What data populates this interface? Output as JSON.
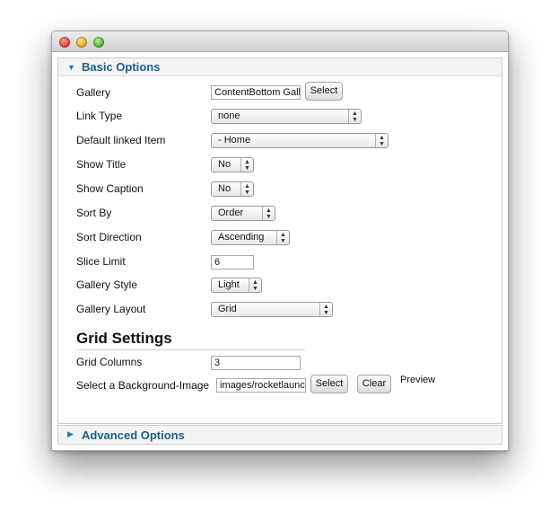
{
  "window": {
    "controls": [
      "close-button",
      "minimize-button",
      "zoom-button"
    ]
  },
  "basic": {
    "title": "Basic Options",
    "arrow": "▼"
  },
  "advanced": {
    "title": "Advanced Options",
    "arrow": "▶"
  },
  "form": {
    "gallery": {
      "label": "Gallery",
      "value": "ContentBottom Gallery",
      "button": "Select"
    },
    "link_type": {
      "label": "Link Type",
      "value": "none"
    },
    "default_linked": {
      "label": "Default linked Item",
      "value": "- Home"
    },
    "show_title": {
      "label": "Show Title",
      "value": "No"
    },
    "show_caption": {
      "label": "Show Caption",
      "value": "No"
    },
    "sort_by": {
      "label": "Sort By",
      "value": "Order"
    },
    "sort_direction": {
      "label": "Sort Direction",
      "value": "Ascending"
    },
    "slice_limit": {
      "label": "Slice Limit",
      "value": "6"
    },
    "gallery_style": {
      "label": "Gallery Style",
      "value": "Light"
    },
    "gallery_layout": {
      "label": "Gallery Layout",
      "value": "Grid"
    }
  },
  "grid": {
    "title": "Grid Settings",
    "columns": {
      "label": "Grid Columns",
      "value": "3"
    },
    "background": {
      "label": "Select a Background-Image",
      "value": "images/rocketlauncher",
      "select": "Select",
      "clear": "Clear",
      "preview": "Preview"
    }
  },
  "caret": "▲▼"
}
